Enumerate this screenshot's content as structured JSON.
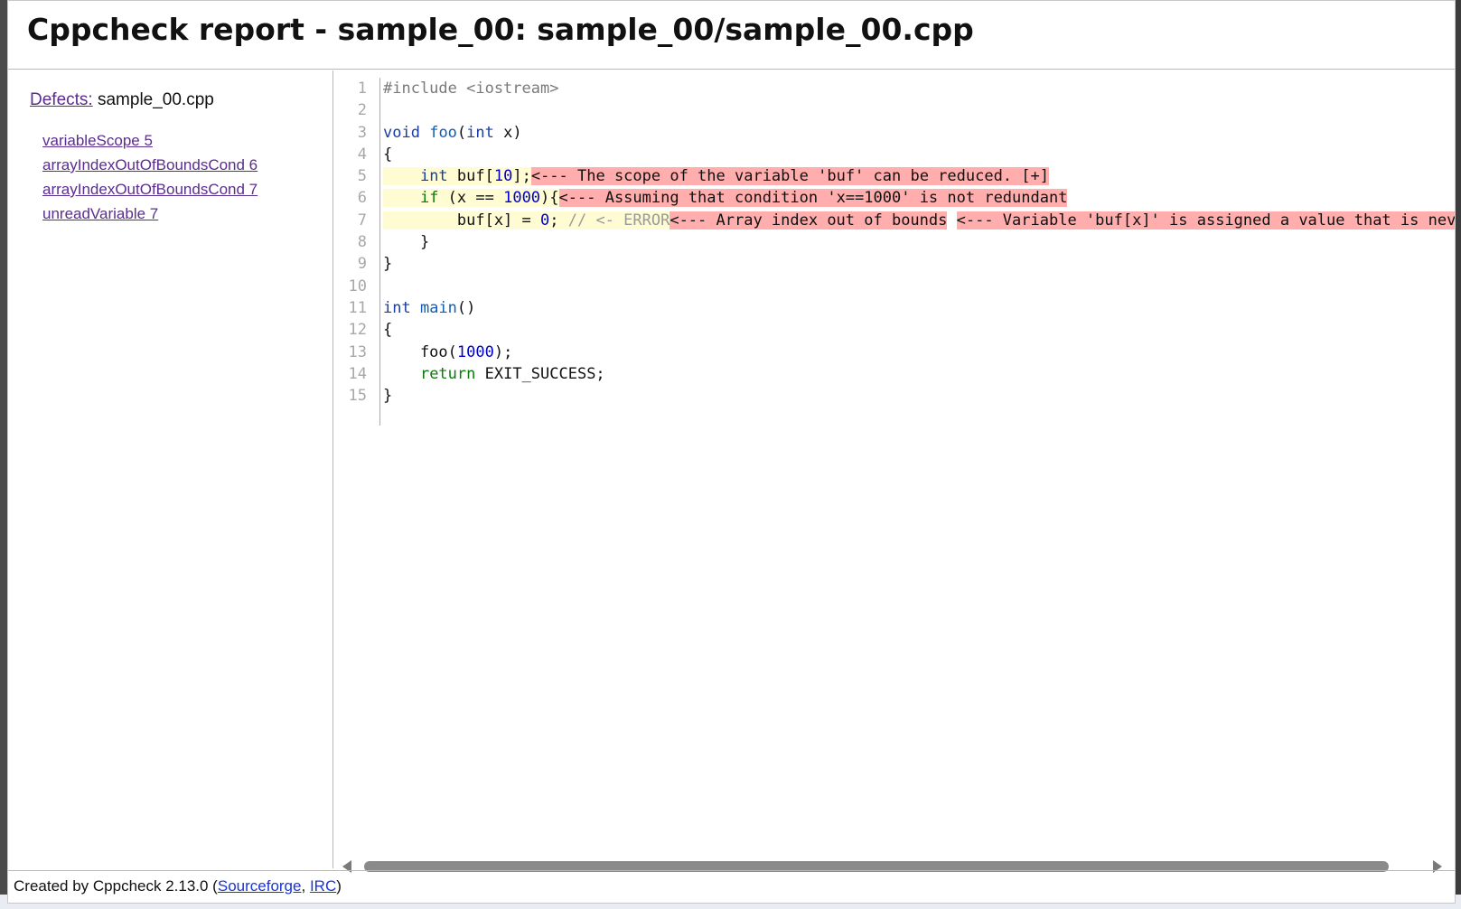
{
  "header": {
    "title": "Cppcheck report - sample_00: sample_00/sample_00.cpp"
  },
  "sidebar": {
    "defects_link": "Defects:",
    "file_name": "sample_00.cpp",
    "defects": [
      "variableScope 5",
      "arrayIndexOutOfBoundsCond 6",
      "arrayIndexOutOfBoundsCond 7",
      "unreadVariable 7"
    ]
  },
  "code": {
    "line_numbers": [
      "1",
      "2",
      "3",
      "4",
      "5",
      "6",
      "7",
      "8",
      "9",
      "10",
      "11",
      "12",
      "13",
      "14",
      "15"
    ],
    "lines": {
      "l1_pp": "#include <iostream>",
      "l3_void": "void",
      "l3_foo": "foo",
      "l3_paren": "(",
      "l3_int": "int",
      "l3_rest": " x)",
      "l4": "{",
      "l5_indent": "    ",
      "l5_int": "int",
      "l5_buf": " buf[",
      "l5_num": "10",
      "l5_end": "];",
      "l5_msg": "<--- The scope of the variable 'buf' can be reduced. [+]",
      "l6_indent": "    ",
      "l6_if": "if",
      "l6_mid": " (x == ",
      "l6_num": "1000",
      "l6_end": "){",
      "l6_msg": "<--- Assuming that condition 'x==1000' is not redundant",
      "l7_indent": "        buf[x] = ",
      "l7_num": "0",
      "l7_semi": "; ",
      "l7_cmt": "// <- ERROR",
      "l7_msg1": "<--- Array index out of bounds",
      "l7_msg2": "<--- Variable 'buf[x]' is assigned a value that is never used.",
      "l8": "    }",
      "l9": "}",
      "l11_int": "int",
      "l11_main": "main",
      "l11_rest": "()",
      "l12": "{",
      "l13_a": "    foo(",
      "l13_num": "1000",
      "l13_b": ");",
      "l14_indent": "    ",
      "l14_ret": "return",
      "l14_rest": " EXIT_SUCCESS;",
      "l15": "}"
    }
  },
  "footer": {
    "prefix": "Created by Cppcheck 2.13.0 (",
    "link1": "Sourceforge",
    "sep": ", ",
    "link2": "IRC",
    "suffix": ")"
  },
  "colors": {
    "error_bg": "#ffadad",
    "highlight_bg": "#fffcd4",
    "link": "#5b2c91"
  }
}
